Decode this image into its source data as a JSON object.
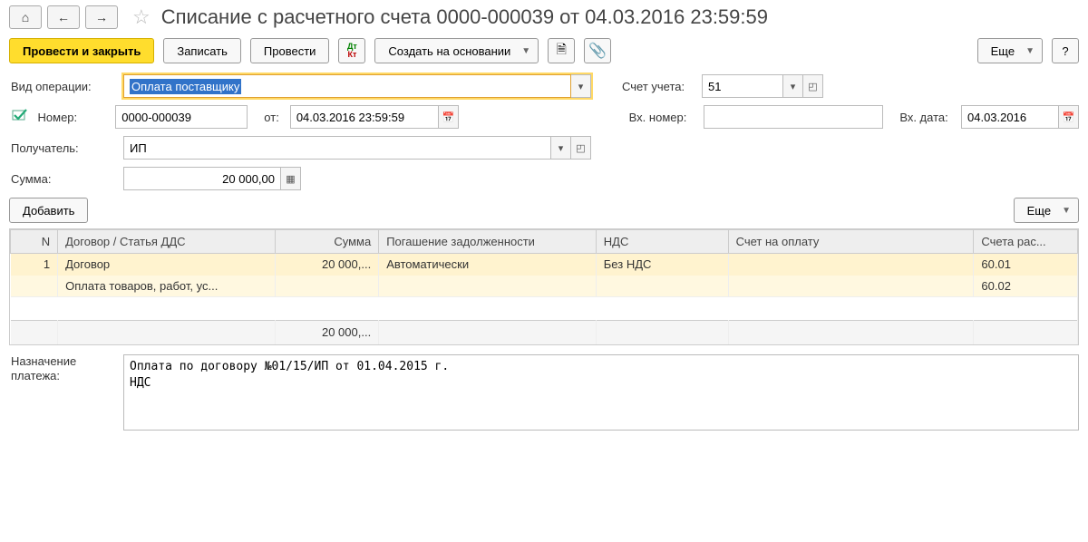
{
  "title": "Списание с расчетного счета 0000-000039 от 04.03.2016 23:59:59",
  "toolbar": {
    "post_close": "Провести и закрыть",
    "save": "Записать",
    "post": "Провести",
    "create_based": "Создать на основании",
    "more": "Еще"
  },
  "form": {
    "op_type_label": "Вид операции:",
    "op_type_value": "Оплата поставщику",
    "account_label": "Счет учета:",
    "account_value": "51",
    "number_label": "Номер:",
    "number_value": "0000-000039",
    "date_label": "от:",
    "date_value": "04.03.2016 23:59:59",
    "in_number_label": "Вх. номер:",
    "in_number_value": "",
    "in_date_label": "Вх. дата:",
    "in_date_value": "04.03.2016",
    "recipient_label": "Получатель:",
    "recipient_value": "ИП",
    "sum_label": "Сумма:",
    "sum_value": "20 000,00",
    "add_label": "Добавить",
    "purpose_label": "Назначение платежа:",
    "purpose_value": "Оплата по договору №01/15/ИП от 01.04.2015 г.\nНДС"
  },
  "table": {
    "headers": {
      "n": "N",
      "contract": "Договор / Статья ДДС",
      "sum": "Сумма",
      "pog": "Погашение задолженности",
      "nds": "НДС",
      "invoice": "Счет на оплату",
      "acc": "Счета рас..."
    },
    "rows": [
      {
        "n": "1",
        "contract1": "Договор",
        "contract2": "Оплата товаров, работ, ус...",
        "sum": "20 000,...",
        "pog": "Автоматически",
        "nds": "Без НДС",
        "invoice": "",
        "acc1": "60.01",
        "acc2": "60.02"
      }
    ],
    "footer_sum": "20 000,..."
  }
}
